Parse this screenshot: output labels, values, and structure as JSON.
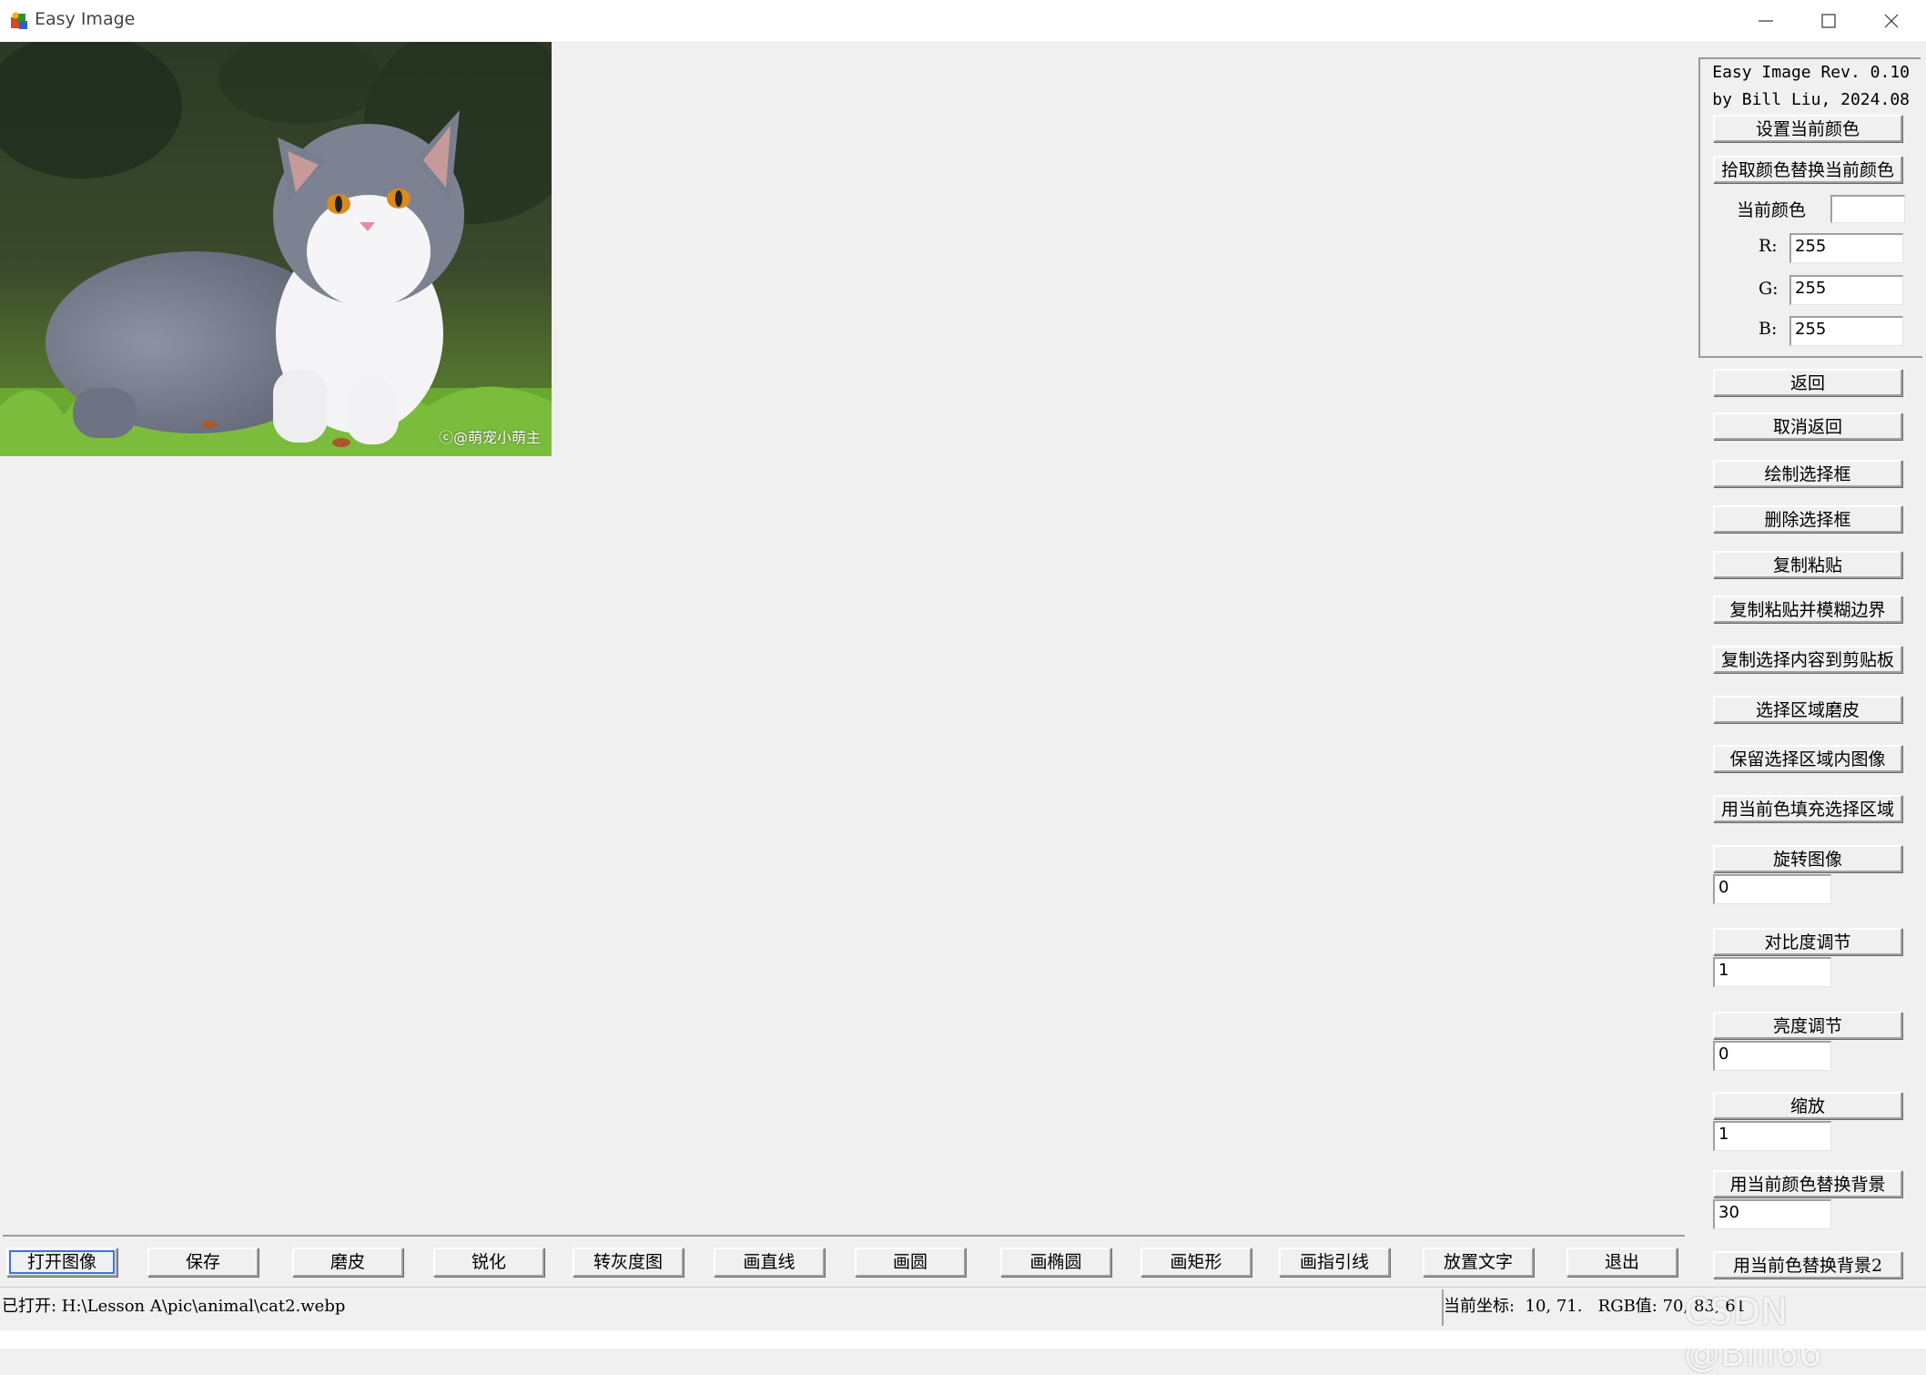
{
  "window": {
    "title": "Easy Image",
    "controls": {
      "minimize": "minimize-icon",
      "maximize": "maximize-icon",
      "close": "close-icon"
    }
  },
  "canvas": {
    "image_watermark": "ⓒ@萌宠小萌主"
  },
  "panel": {
    "info_line1": "Easy Image Rev. 0.10",
    "info_line2": "by Bill Liu, 2024.08",
    "set_color_button": "设置当前颜色",
    "pick_color_button": "拾取颜色替换当前颜色",
    "current_color_label": "当前颜色",
    "current_color_swatch": "#ffffff",
    "r_label": "R:",
    "r_value": "255",
    "g_label": "G:",
    "g_value": "255",
    "b_label": "B:",
    "b_value": "255",
    "undo_button": "返回",
    "redo_button": "取消返回",
    "draw_selection_button": "绘制选择框",
    "delete_selection_button": "删除选择框",
    "copy_paste_button": "复制粘贴",
    "copy_paste_blur_button": "复制粘贴并模糊边界",
    "copy_to_clipboard_button": "复制选择内容到剪贴板",
    "smooth_region_button": "选择区域磨皮",
    "keep_region_button": "保留选择区域内图像",
    "fill_region_button": "用当前色填充选择区域",
    "rotate_button": "旋转图像",
    "rotate_value": "0",
    "contrast_button": "对比度调节",
    "contrast_value": "1",
    "brightness_button": "亮度调节",
    "brightness_value": "0",
    "zoom_button": "缩放",
    "zoom_value": "1",
    "replace_bg_button": "用当前颜色替换背景",
    "replace_bg_value": "30",
    "replace_bg2_button": "用当前色替换背景2"
  },
  "toolbar": {
    "buttons": [
      "打开图像",
      "保存",
      "磨皮",
      "锐化",
      "转灰度图",
      "画直线",
      "画圆",
      "画椭圆",
      "画矩形",
      "画指引线",
      "放置文字",
      "退出"
    ]
  },
  "status": {
    "file": "已打开: H:\\Lesson A\\pic\\animal\\cat2.webp",
    "coord": "当前坐标:  10, 71.   RGB值: 70, 83, 61"
  },
  "overlay": {
    "watermark": "CSDN @Bill66"
  }
}
